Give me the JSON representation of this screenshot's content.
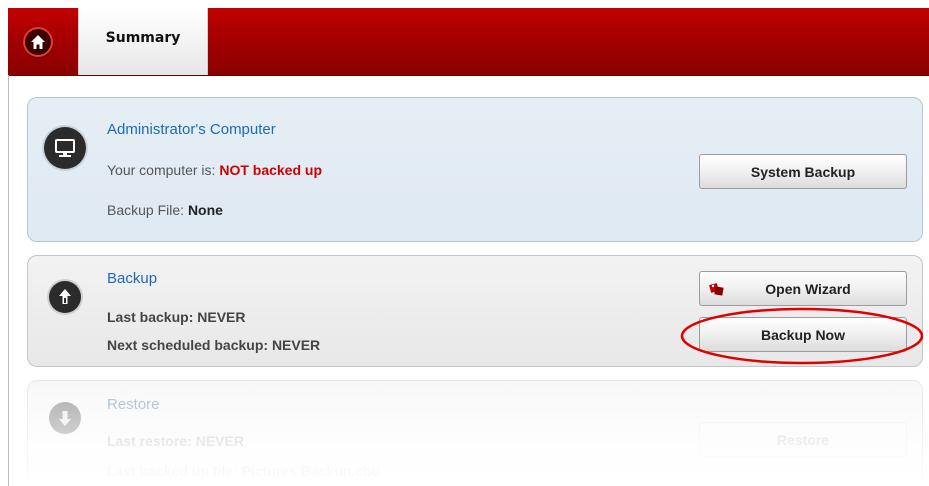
{
  "header": {
    "tab_summary": "Summary",
    "home_icon": "home-icon",
    "accent_color": "#b00000"
  },
  "computer_panel": {
    "title": "Administrator's Computer",
    "status_prefix": "Your computer is: ",
    "status_value": "NOT backed up",
    "file_label": "Backup File: ",
    "file_value": "None",
    "button": "System Backup",
    "icon": "monitor-icon"
  },
  "backup_panel": {
    "title": "Backup",
    "last_label": "Last backup: ",
    "last_value": "NEVER",
    "next_label": "Next scheduled backup: ",
    "next_value": "NEVER",
    "wizard_button": "Open Wizard",
    "now_button": "Backup Now",
    "icon": "backup-upload-icon",
    "highlight_color": "#e00000"
  },
  "restore_panel": {
    "title": "Restore",
    "last_label": "Last restore: ",
    "last_value": "NEVER",
    "file_label": "Last backed up file: ",
    "file_value": "Pictures Backup.cbu",
    "button": "Restore",
    "icon": "restore-download-icon"
  }
}
